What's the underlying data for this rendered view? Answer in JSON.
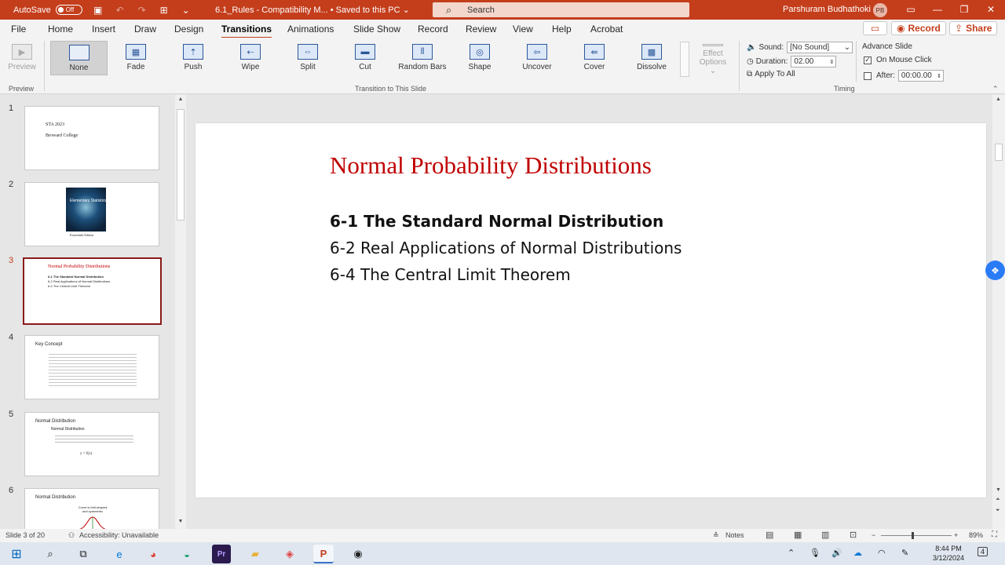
{
  "titlebar": {
    "autosave_label": "AutoSave",
    "autosave_state": "Off",
    "doc_title": "6.1_Rules  -  Compatibility M...  •  Saved to this PC  ⌄",
    "search_placeholder": "Search",
    "user_name": "Parshuram Budhathoki",
    "user_initials": "PB",
    "brand_color": "#c43e1c"
  },
  "menu": {
    "tabs": [
      "File",
      "Home",
      "Insert",
      "Draw",
      "Design",
      "Transitions",
      "Animations",
      "Slide Show",
      "Record",
      "Review",
      "View",
      "Help",
      "Acrobat"
    ],
    "active": "Transitions",
    "record_label": "Record",
    "share_label": "Share"
  },
  "ribbon": {
    "preview_label": "Preview",
    "preview_group": "Preview",
    "transitions": [
      "None",
      "Fade",
      "Push",
      "Wipe",
      "Split",
      "Cut",
      "Random Bars",
      "Shape",
      "Uncover",
      "Cover",
      "Dissolve"
    ],
    "selected_transition": "None",
    "effect_options_label": "Effect Options ⌄",
    "transition_group": "Transition to This Slide",
    "sound_label": "Sound:",
    "sound_value": "[No Sound]",
    "duration_label": "Duration:",
    "duration_value": "02.00",
    "apply_all_label": "Apply To All",
    "advance_label": "Advance Slide",
    "on_mouse_click_label": "On Mouse Click",
    "on_mouse_click_checked": true,
    "after_label": "After:",
    "after_checked": false,
    "after_value": "00:00.00",
    "timing_group": "Timing"
  },
  "thumbnails": [
    {
      "num": "1",
      "lines": [
        "STA 2023",
        "Broward College"
      ]
    },
    {
      "num": "2",
      "lines": [
        "Elementary Statistics",
        "Fourteenth Edition"
      ]
    },
    {
      "num": "3",
      "lines": [
        "Normal Probability Distributions",
        "6-1  The Standard Normal Distribution",
        "6-2  Real Applications of Normal Distributions",
        "6-4  The Central Limit Theorem"
      ]
    },
    {
      "num": "4",
      "lines": [
        "Key Concept"
      ]
    },
    {
      "num": "5",
      "lines": [
        "Normal Distribution",
        "Normal Distribution"
      ]
    },
    {
      "num": "6",
      "lines": [
        "Normal Distribution",
        "Curve is bell-shaped and symmetric"
      ]
    }
  ],
  "active_slide_index": 2,
  "slide": {
    "title": "Normal Probability Distributions",
    "bullets": [
      {
        "text": "6-1  The Standard Normal Distribution",
        "bold": true
      },
      {
        "text": "6-2  Real Applications of Normal Distributions",
        "bold": false
      },
      {
        "text": "6-4  The Central Limit Theorem",
        "bold": false
      }
    ],
    "title_color": "#c00000"
  },
  "status": {
    "slide_info": "Slide 3 of 20",
    "accessibility": "Accessibility: Unavailable",
    "notes_label": "Notes",
    "zoom": "89%"
  },
  "taskbar": {
    "time": "8:44 PM",
    "date": "3/12/2024",
    "notification_count": "4"
  }
}
